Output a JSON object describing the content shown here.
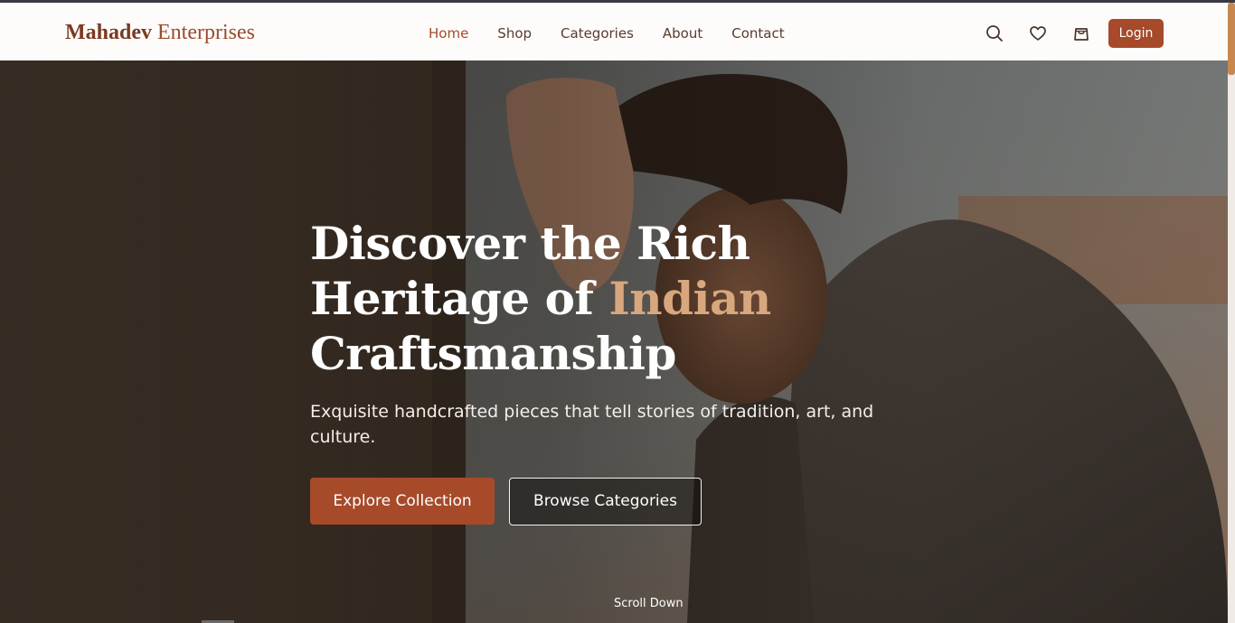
{
  "brand": {
    "name_bold": "Mahadev",
    "name_light": "Enterprises"
  },
  "nav": {
    "items": [
      {
        "label": "Home",
        "active": true
      },
      {
        "label": "Shop",
        "active": false
      },
      {
        "label": "Categories",
        "active": false
      },
      {
        "label": "About",
        "active": false
      },
      {
        "label": "Contact",
        "active": false
      }
    ],
    "icons": [
      "search-icon",
      "heart-icon",
      "shopping-bag-icon"
    ],
    "login_label": "Login"
  },
  "hero": {
    "title_line1": "Discover the Rich",
    "title_line2_prefix": "Heritage of ",
    "title_line2_accent": "Indian",
    "title_line3": "Craftsmanship",
    "subtitle": "Exquisite handcrafted pieces that tell stories of tradition, art, and culture.",
    "primary_button": "Explore Collection",
    "secondary_button": "Browse Categories",
    "scroll_label": "Scroll Down"
  },
  "colors": {
    "accent": "#a64a2a",
    "accent_text": "#d8a77e",
    "nav_text": "#5b3a2c"
  }
}
